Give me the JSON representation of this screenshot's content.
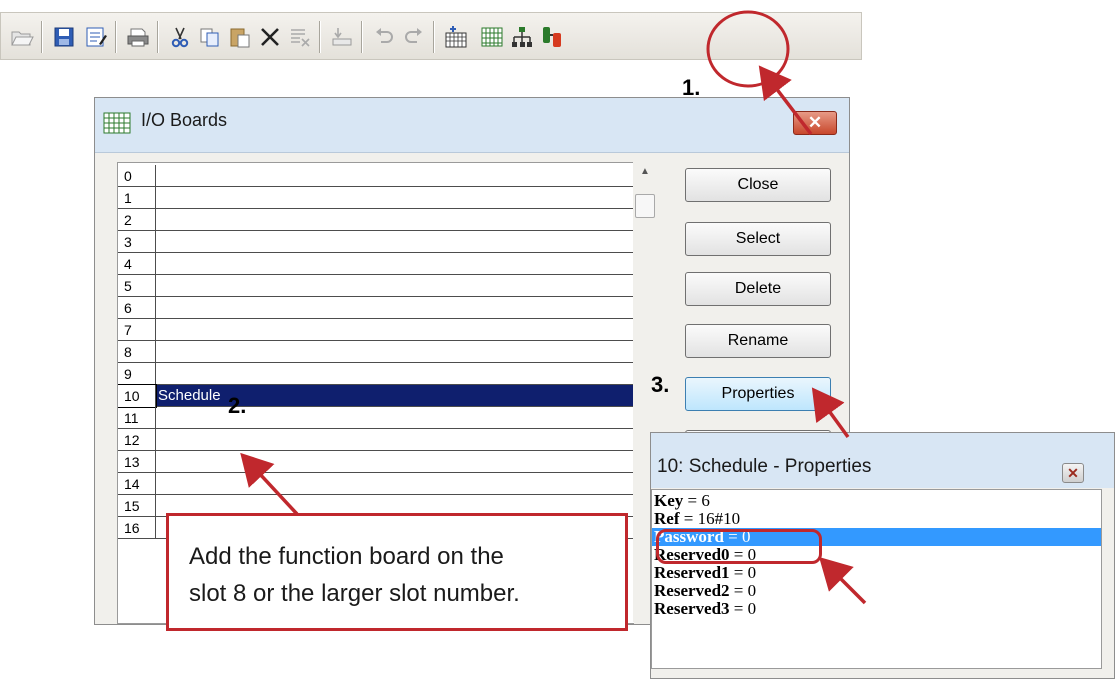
{
  "toolbar": {
    "items": [
      "open-icon",
      "save-icon",
      "save-as-icon",
      "print-icon",
      "cut-icon",
      "copy-icon",
      "paste-icon",
      "delete-icon",
      "replace-icon",
      "insert-icon",
      "undo-icon",
      "redo-icon",
      "add-board-icon",
      "io-boards-icon",
      "network-icon",
      "link-icon"
    ]
  },
  "io_dialog": {
    "title": "I/O Boards",
    "close_glyph": "✕",
    "slots": [
      {
        "num": "0",
        "name": ""
      },
      {
        "num": "1",
        "name": ""
      },
      {
        "num": "2",
        "name": ""
      },
      {
        "num": "3",
        "name": ""
      },
      {
        "num": "4",
        "name": ""
      },
      {
        "num": "5",
        "name": ""
      },
      {
        "num": "6",
        "name": ""
      },
      {
        "num": "7",
        "name": ""
      },
      {
        "num": "8",
        "name": ""
      },
      {
        "num": "9",
        "name": ""
      },
      {
        "num": "10",
        "name": "Schedule"
      },
      {
        "num": "11",
        "name": ""
      },
      {
        "num": "12",
        "name": ""
      },
      {
        "num": "13",
        "name": ""
      },
      {
        "num": "14",
        "name": ""
      },
      {
        "num": "15",
        "name": ""
      },
      {
        "num": "16",
        "name": ""
      }
    ],
    "buttons": {
      "close": "Close",
      "select": "Select",
      "delete": "Delete",
      "rename": "Rename",
      "properties": "Properties"
    }
  },
  "props_dialog": {
    "title": "10: Schedule - Properties",
    "close_glyph": "✕",
    "rows": [
      {
        "key": "Key",
        "value": "6"
      },
      {
        "key": "Ref",
        "value": "16#10"
      },
      {
        "key": "Password",
        "value": "0"
      },
      {
        "key": "Reserved0",
        "value": "0"
      },
      {
        "key": "Reserved1",
        "value": "0"
      },
      {
        "key": "Reserved2",
        "value": "0"
      },
      {
        "key": "Reserved3",
        "value": "0"
      }
    ]
  },
  "annotations": {
    "step1": "1.",
    "step2": "2.",
    "step3": "3.",
    "callout_line1": "Add the function board on the",
    "callout_line2": "slot 8 or the larger slot number.",
    "highlight_color": "#c0282d"
  }
}
